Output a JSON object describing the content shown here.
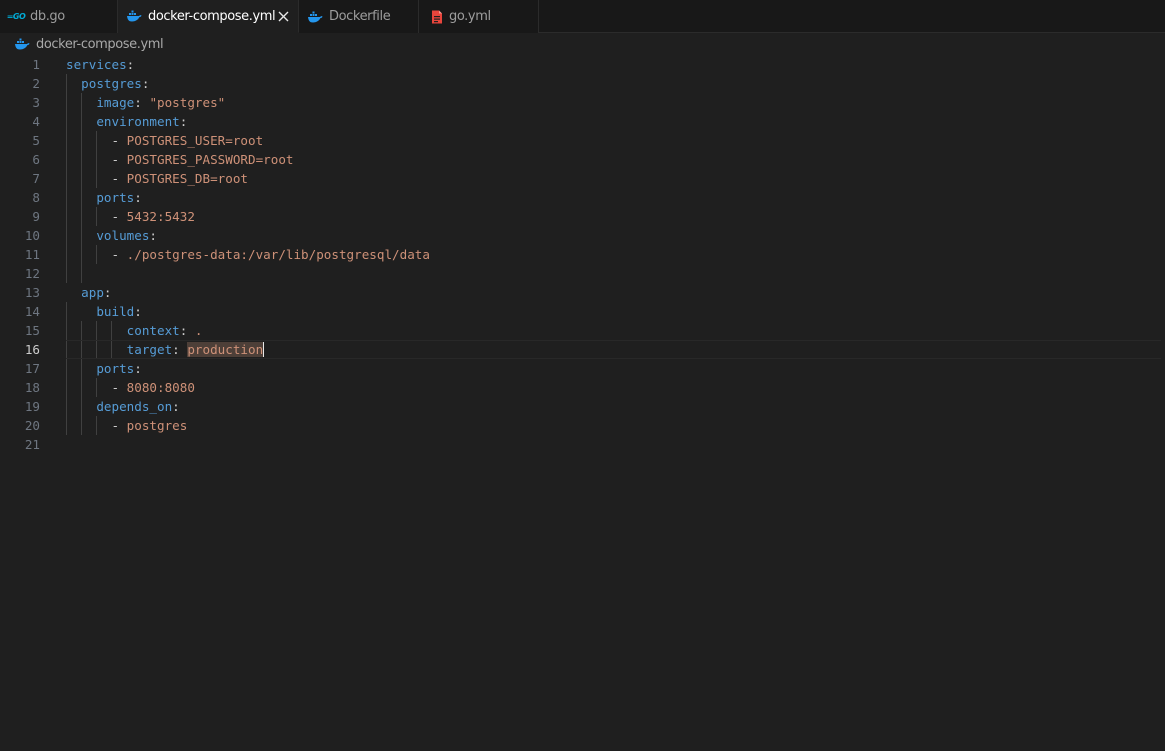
{
  "tabs": [
    {
      "label": "db.go",
      "icon": "go-icon",
      "icon_text": "=GO",
      "active": false
    },
    {
      "label": "docker-compose.yml",
      "icon": "docker-icon",
      "active": true
    },
    {
      "label": "Dockerfile",
      "icon": "docker-icon",
      "active": false
    },
    {
      "label": "go.yml",
      "icon": "yaml-file-icon",
      "active": false
    }
  ],
  "breadcrumb": {
    "label": "docker-compose.yml",
    "icon": "docker-icon"
  },
  "editor": {
    "current_line": 16,
    "line_numbers": [
      "1",
      "2",
      "3",
      "4",
      "5",
      "6",
      "7",
      "8",
      "9",
      "10",
      "11",
      "12",
      "13",
      "14",
      "15",
      "16",
      "17",
      "18",
      "19",
      "20",
      "21"
    ],
    "lines": [
      {
        "indent": "",
        "key": "services",
        "colon": ":",
        "value": ""
      },
      {
        "indent": "  ",
        "key": "postgres",
        "colon": ":",
        "value": ""
      },
      {
        "indent": "    ",
        "key": "image",
        "colon": ": ",
        "value": "\"postgres\""
      },
      {
        "indent": "    ",
        "key": "environment",
        "colon": ":",
        "value": ""
      },
      {
        "indent": "      ",
        "dash": "- ",
        "value": "POSTGRES_USER=root"
      },
      {
        "indent": "      ",
        "dash": "- ",
        "value": "POSTGRES_PASSWORD=root"
      },
      {
        "indent": "      ",
        "dash": "- ",
        "value": "POSTGRES_DB=root"
      },
      {
        "indent": "    ",
        "key": "ports",
        "colon": ":",
        "value": ""
      },
      {
        "indent": "      ",
        "dash": "- ",
        "value": "5432:5432"
      },
      {
        "indent": "    ",
        "key": "volumes",
        "colon": ":",
        "value": ""
      },
      {
        "indent": "      ",
        "dash": "- ",
        "value": "./postgres-data:/var/lib/postgresql/data"
      },
      {
        "indent": "",
        "key": "",
        "colon": "",
        "value": ""
      },
      {
        "indent": "  ",
        "key": "app",
        "colon": ":",
        "value": ""
      },
      {
        "indent": "    ",
        "key": "build",
        "colon": ":",
        "value": ""
      },
      {
        "indent": "        ",
        "key": "context",
        "colon": ": ",
        "value": "."
      },
      {
        "indent": "        ",
        "key": "target",
        "colon": ": ",
        "value": "production",
        "selected": true
      },
      {
        "indent": "    ",
        "key": "ports",
        "colon": ":",
        "value": ""
      },
      {
        "indent": "      ",
        "dash": "- ",
        "value": "8080:8080"
      },
      {
        "indent": "    ",
        "key": "depends_on",
        "colon": ":",
        "value": ""
      },
      {
        "indent": "      ",
        "dash": "- ",
        "value": "postgres"
      },
      {
        "indent": "",
        "key": "",
        "colon": "",
        "value": ""
      }
    ]
  },
  "colors": {
    "background": "#1f1f1f",
    "tabbar": "#181818",
    "key": "#569cd6",
    "string": "#ce9178",
    "punctuation": "#cccccc",
    "line_number": "#6e7681",
    "line_number_active": "#cccccc",
    "docker_blue": "#2496ed",
    "yaml_red": "#e8453c",
    "selection": "#4d3f38"
  }
}
